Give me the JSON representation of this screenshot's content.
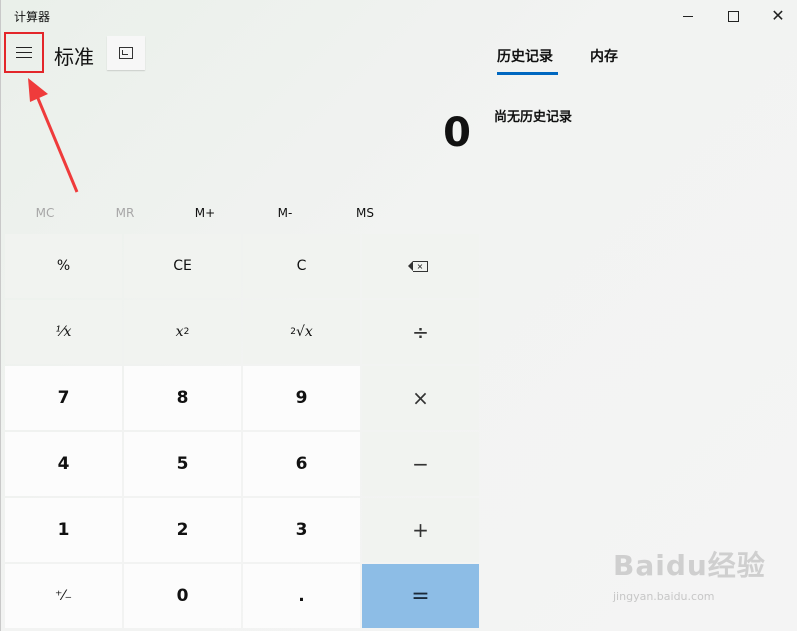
{
  "window": {
    "title": "计算器",
    "minimize_glyph": "—",
    "maximize_glyph": "□",
    "close_glyph": "✕"
  },
  "header": {
    "menu_icon": "hamburger-icon",
    "mode_title": "标准",
    "keep_on_top_icon": "keep-on-top-icon"
  },
  "display": {
    "value": "0"
  },
  "memory": {
    "buttons": [
      {
        "label": "MC",
        "enabled": false
      },
      {
        "label": "MR",
        "enabled": false
      },
      {
        "label": "M+",
        "enabled": true
      },
      {
        "label": "M-",
        "enabled": true
      },
      {
        "label": "MS",
        "enabled": true
      }
    ]
  },
  "keys": {
    "percent": "%",
    "ce": "CE",
    "c": "C",
    "backspace_icon": "backspace-icon",
    "reciprocal": "¹⁄x",
    "square_base": "x",
    "square_exp": "2",
    "sqrt_index": "2",
    "sqrt_symbol": "√",
    "sqrt_var": "x",
    "divide": "÷",
    "seven": "7",
    "eight": "8",
    "nine": "9",
    "multiply": "×",
    "four": "4",
    "five": "5",
    "six": "6",
    "minus": "−",
    "one": "1",
    "two": "2",
    "three": "3",
    "plus": "+",
    "negate": "⁺⁄₋",
    "zero": "0",
    "decimal": ".",
    "equals": "="
  },
  "panel": {
    "tabs": [
      {
        "label": "历史记录",
        "active": true
      },
      {
        "label": "内存",
        "active": false
      }
    ],
    "empty_message": "尚无历史记录"
  },
  "watermark": {
    "logo": "Baidu经验",
    "url": "jingyan.baidu.com"
  },
  "colors": {
    "equals_key": "#8dbde6",
    "tab_accent": "#0067c0",
    "highlight_box": "#e3262a",
    "annotation_arrow": "#ef3b3b"
  }
}
